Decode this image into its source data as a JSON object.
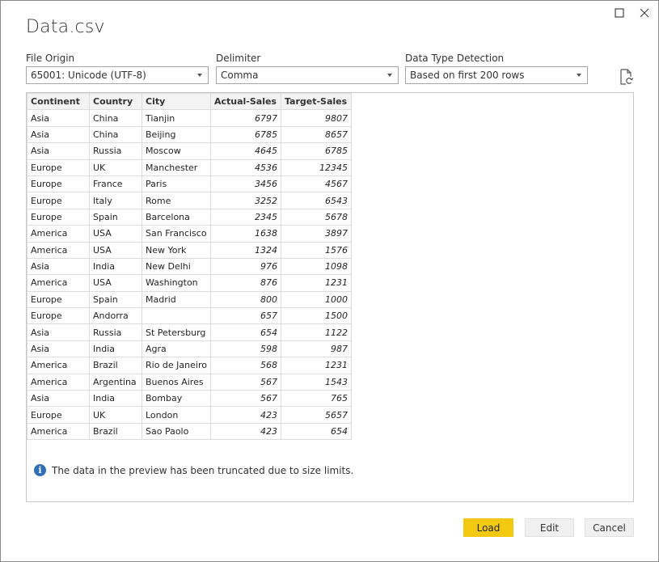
{
  "window": {
    "title": "Data.csv"
  },
  "file_origin": {
    "label": "File Origin",
    "value": "65001: Unicode (UTF-8)"
  },
  "delimiter": {
    "label": "Delimiter",
    "value": "Comma"
  },
  "data_type_detection": {
    "label": "Data Type Detection",
    "value": "Based on first 200 rows"
  },
  "table": {
    "columns": [
      "Continent",
      "Country",
      "City",
      "Actual-Sales",
      "Target-Sales"
    ],
    "rows": [
      [
        "Asia",
        "China",
        "Tianjin",
        "6797",
        "9807"
      ],
      [
        "Asia",
        "China",
        "Beijing",
        "6785",
        "8657"
      ],
      [
        "Asia",
        "Russia",
        "Moscow",
        "4645",
        "6785"
      ],
      [
        "Europe",
        "UK",
        "Manchester",
        "4536",
        "12345"
      ],
      [
        "Europe",
        "France",
        "Paris",
        "3456",
        "4567"
      ],
      [
        "Europe",
        "Italy",
        "Rome",
        "3252",
        "6543"
      ],
      [
        "Europe",
        "Spain",
        "Barcelona",
        "2345",
        "5678"
      ],
      [
        "America",
        "USA",
        "San Francisco",
        "1638",
        "3897"
      ],
      [
        "America",
        "USA",
        "New York",
        "1324",
        "1576"
      ],
      [
        "Asia",
        "India",
        "New Delhi",
        "976",
        "1098"
      ],
      [
        "America",
        "USA",
        "Washington",
        "876",
        "1231"
      ],
      [
        "Europe",
        "Spain",
        "Madrid",
        "800",
        "1000"
      ],
      [
        "Europe",
        "Andorra",
        "",
        "657",
        "1500"
      ],
      [
        "Asia",
        "Russia",
        "St Petersburg",
        "654",
        "1122"
      ],
      [
        "Asia",
        "India",
        "Agra",
        "598",
        "987"
      ],
      [
        "America",
        "Brazil",
        "Rio de Janeiro",
        "568",
        "1231"
      ],
      [
        "America",
        "Argentina",
        "Buenos Aires",
        "567",
        "1543"
      ],
      [
        "Asia",
        "India",
        "Bombay",
        "567",
        "765"
      ],
      [
        "Europe",
        "UK",
        "London",
        "423",
        "5657"
      ],
      [
        "America",
        "Brazil",
        "Sao Paolo",
        "423",
        "654"
      ]
    ]
  },
  "notice": {
    "icon": "info-icon",
    "text": "The data in the preview has been truncated due to size limits."
  },
  "buttons": {
    "load": "Load",
    "edit": "Edit",
    "cancel": "Cancel"
  },
  "colors": {
    "load_button": "#f2c811",
    "info_icon": "#2f6fb7"
  }
}
